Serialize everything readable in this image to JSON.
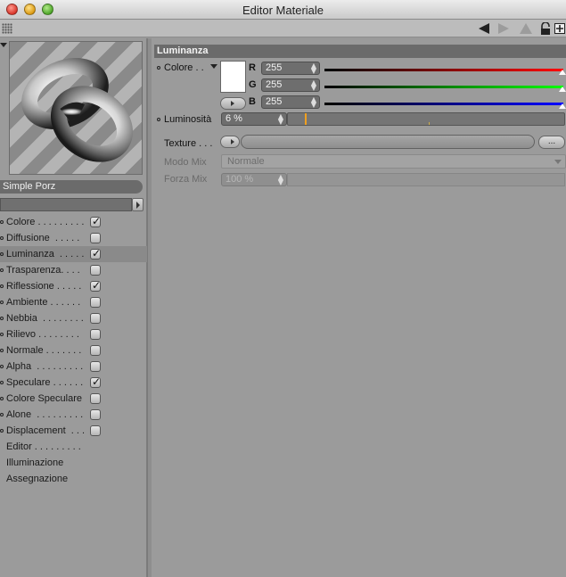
{
  "window": {
    "title": "Editor Materiale"
  },
  "toolbar": {
    "icons": [
      "back-arrow-icon",
      "forward-arrow-icon",
      "up-arrow-icon",
      "lock-icon",
      "new-window-icon"
    ]
  },
  "material": {
    "name": "Simple Porz"
  },
  "channels": [
    {
      "label": "Colore . . . . . . . . .",
      "checked": true
    },
    {
      "label": "Diffusione  . . . . .",
      "checked": false
    },
    {
      "label": "Luminanza  . . . . .",
      "checked": true,
      "active": true
    },
    {
      "label": "Trasparenza. . . .",
      "checked": false
    },
    {
      "label": "Riflessione . . . . .",
      "checked": true
    },
    {
      "label": "Ambiente . . . . . .",
      "checked": false
    },
    {
      "label": "Nebbia  . . . . . . . .",
      "checked": false
    },
    {
      "label": "Rilievo . . . . . . . .",
      "checked": false
    },
    {
      "label": "Normale . . . . . . .",
      "checked": false
    },
    {
      "label": "Alpha  . . . . . . . . .",
      "checked": false
    },
    {
      "label": "Speculare . . . . . .",
      "checked": true
    },
    {
      "label": "Colore Speculare",
      "checked": false
    },
    {
      "label": "Alone  . . . . . . . . .",
      "checked": false
    },
    {
      "label": "Displacement  . . .",
      "checked": false
    }
  ],
  "extra_items": [
    "Editor . . . . . . . . .",
    "Illuminazione",
    "Assegnazione"
  ],
  "section": {
    "title": "Luminanza",
    "colore_label": "Colore . .",
    "r_label": "R",
    "g_label": "G",
    "b_label": "B",
    "r_value": "255",
    "g_value": "255",
    "b_value": "255",
    "luminosita_label": "Luminosità",
    "luminosita_value": "6 %",
    "luminosita_fraction": 0.06,
    "texture_label": "Texture . . .",
    "texture_dots": "...",
    "modo_mix_label": "Modo Mix",
    "modo_mix_value": "Normale",
    "forza_mix_label": "Forza Mix",
    "forza_mix_value": "100 %"
  },
  "colors": {
    "swatch": "#ffffff",
    "accent_marker": "#f0a020",
    "header_bg": "#6b6b6b"
  }
}
